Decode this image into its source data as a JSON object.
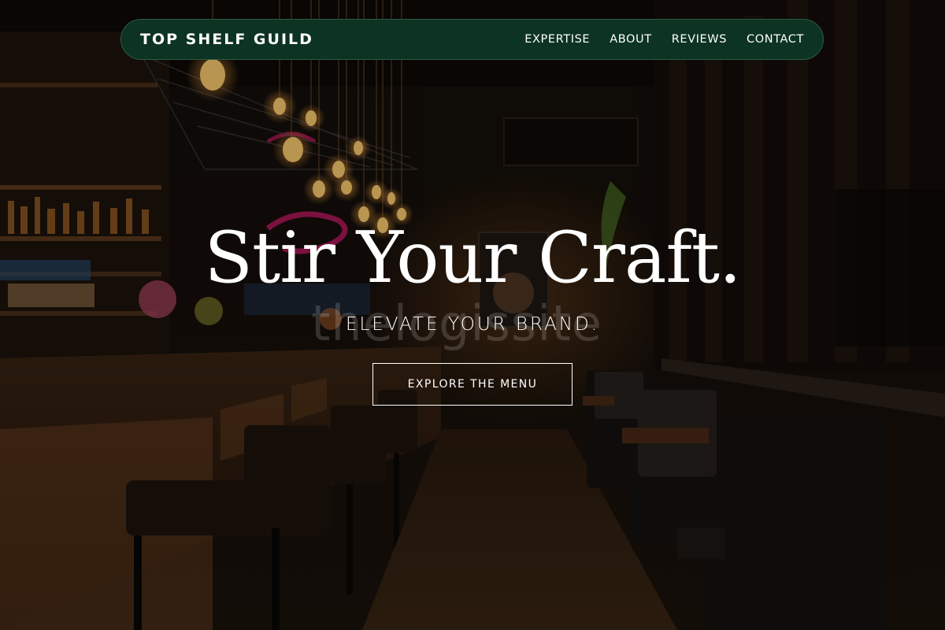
{
  "nav": {
    "brand": "TOP SHELF GUILD",
    "links": [
      "EXPERTISE",
      "ABOUT",
      "REVIEWS",
      "CONTACT"
    ]
  },
  "hero": {
    "headline": "Stir Your Craft.",
    "subheadline": "ELEVATE YOUR BRAND.",
    "cta_label": "EXPLORE THE MENU",
    "watermark": "thelogissite"
  },
  "colors": {
    "nav_background": "#0d3322",
    "text": "#ffffff",
    "neon_pink": "#d11a6a",
    "bulb_amber": "#f0a040"
  }
}
